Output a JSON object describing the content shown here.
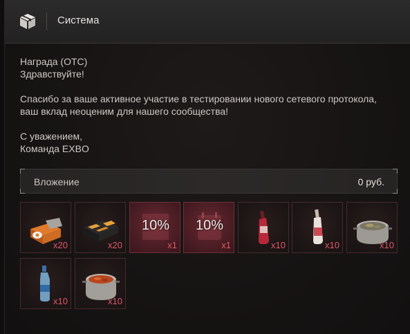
{
  "header": {
    "title": "Система",
    "icon": "package-icon"
  },
  "message": {
    "line1": "Награда (ОТС)",
    "line2": "Здравствуйте!",
    "para1": "Спасибо за ваше активное участие в тестировании нового сетевого протокола, ваш вклад неоценим для нашего сообщества!",
    "sign1": "С уважением,",
    "sign2": "Команда EXBO"
  },
  "investment": {
    "label": "Вложение",
    "value": "0 руб."
  },
  "rewards": [
    {
      "icon": "food-box-icon",
      "qty": "x20"
    },
    {
      "icon": "ammo-box-icon",
      "qty": "x20"
    },
    {
      "icon": "discount-coupon-icon",
      "badge": "10%",
      "qty": "x1"
    },
    {
      "icon": "discount-calendar-icon",
      "badge": "10%",
      "qty": "x1"
    },
    {
      "icon": "red-bottle-icon",
      "qty": "x10"
    },
    {
      "icon": "white-bottle-icon",
      "qty": "x10"
    },
    {
      "icon": "stew-pot-icon",
      "qty": "x10"
    },
    {
      "icon": "water-bottle-icon",
      "qty": "x10"
    },
    {
      "icon": "borscht-pot-icon",
      "qty": "x10"
    }
  ],
  "colors": {
    "accent": "#e0576a",
    "background": "#161313"
  }
}
